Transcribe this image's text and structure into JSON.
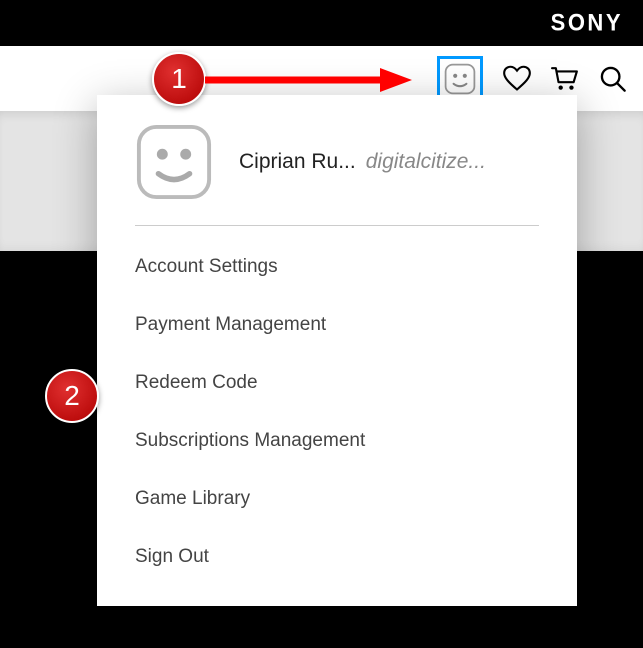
{
  "topbar": {
    "brand": "SONY"
  },
  "user": {
    "display_name": "Ciprian Ru...",
    "handle": "digitalcitize..."
  },
  "menu": {
    "account_settings": "Account Settings",
    "payment_management": "Payment Management",
    "redeem_code": "Redeem Code",
    "subscriptions_management": "Subscriptions Management",
    "game_library": "Game Library",
    "sign_out": "Sign Out"
  },
  "annotations": {
    "step1": "1",
    "step2": "2"
  }
}
